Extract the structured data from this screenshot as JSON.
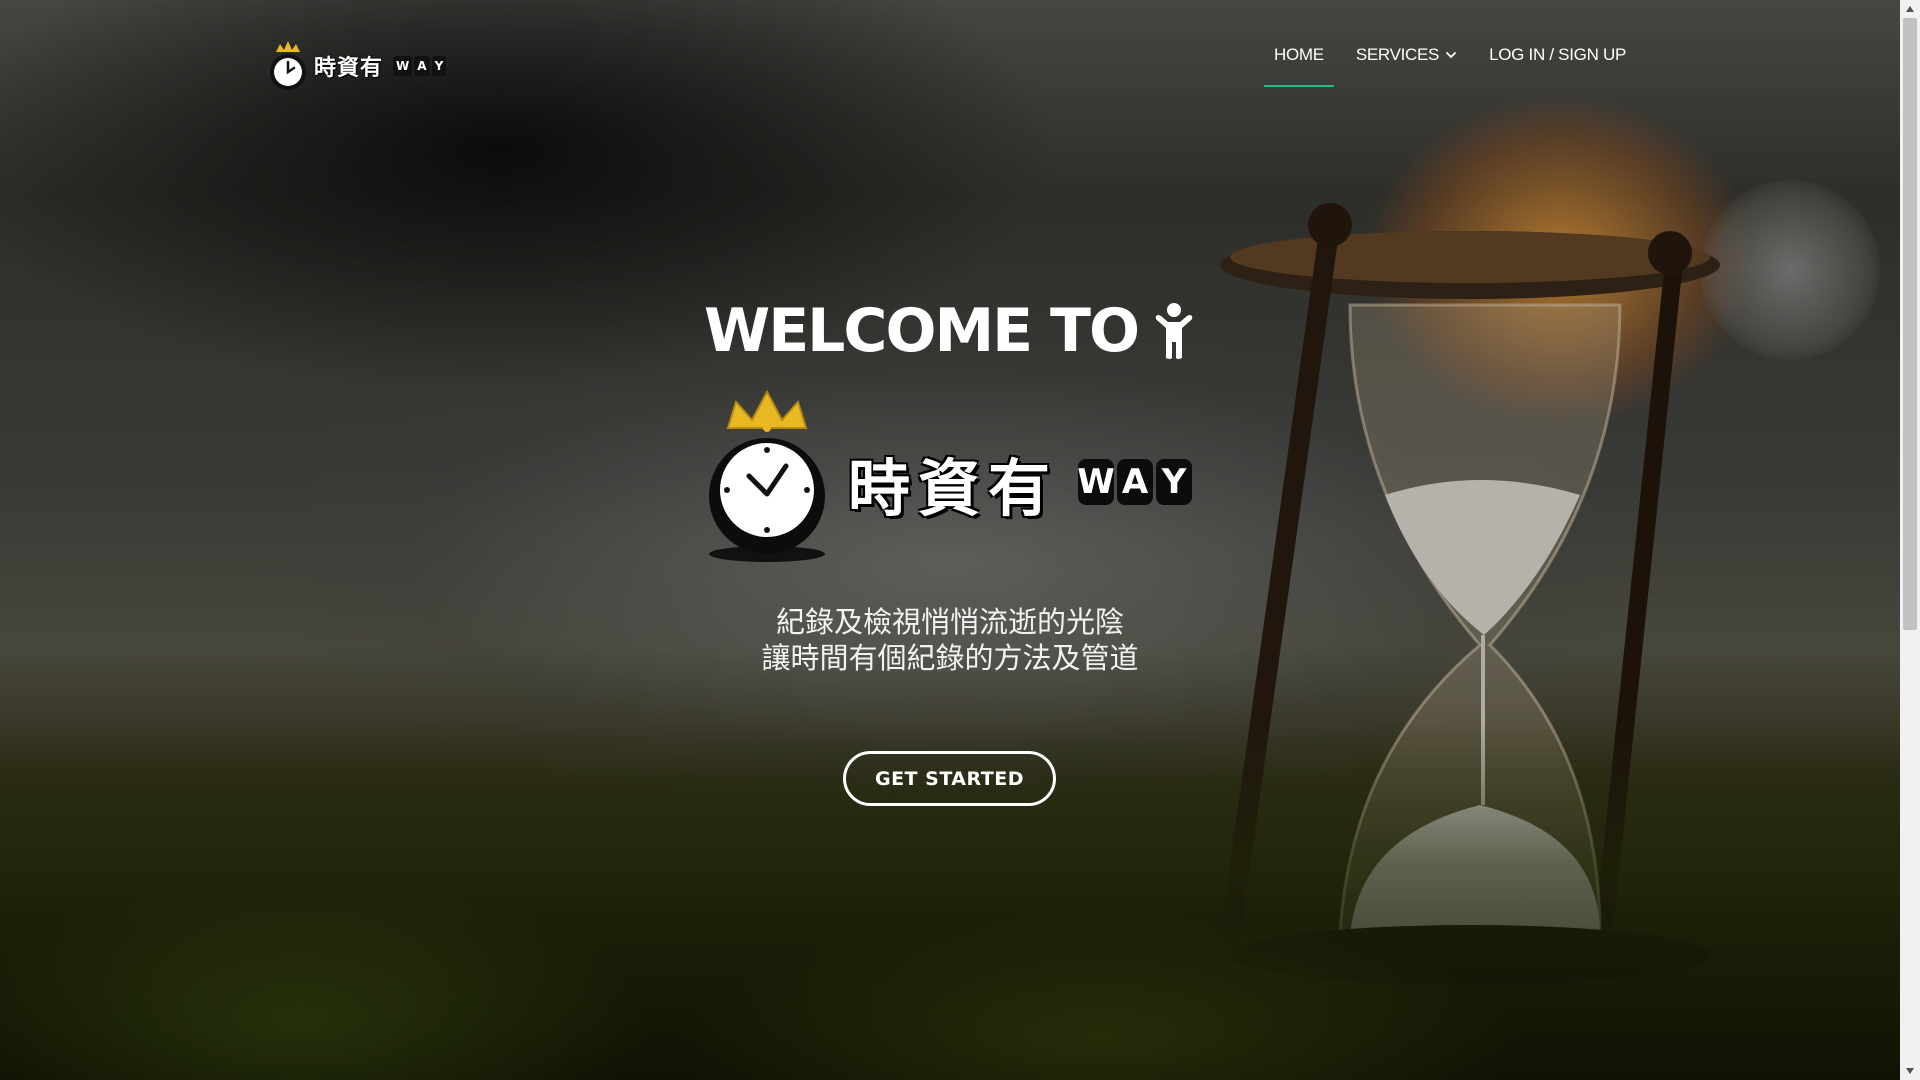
{
  "brand": {
    "name": "時資有",
    "way_letters": [
      "W",
      "A",
      "Y"
    ]
  },
  "nav": {
    "home": "HOME",
    "services": "SERVICES",
    "login": "LOG IN / SIGN UP"
  },
  "hero": {
    "welcome": "WELCOME TO",
    "logo_text": "時資有",
    "logo_way": [
      "W",
      "A",
      "Y"
    ],
    "tagline_line1": "紀錄及檢視悄悄流逝的光陰",
    "tagline_line2": "讓時間有個紀錄的方法及管道",
    "cta": "GET STARTED"
  },
  "colors": {
    "accent": "#1bbd8c",
    "crown": "#e8b923",
    "white": "#ffffff"
  },
  "icons": {
    "brand": "clock-crown-icon",
    "services_dropdown": "chevron-down-icon",
    "welcome": "person-icon",
    "scroll_up": "triangle-up-icon",
    "scroll_down": "triangle-down-icon"
  }
}
